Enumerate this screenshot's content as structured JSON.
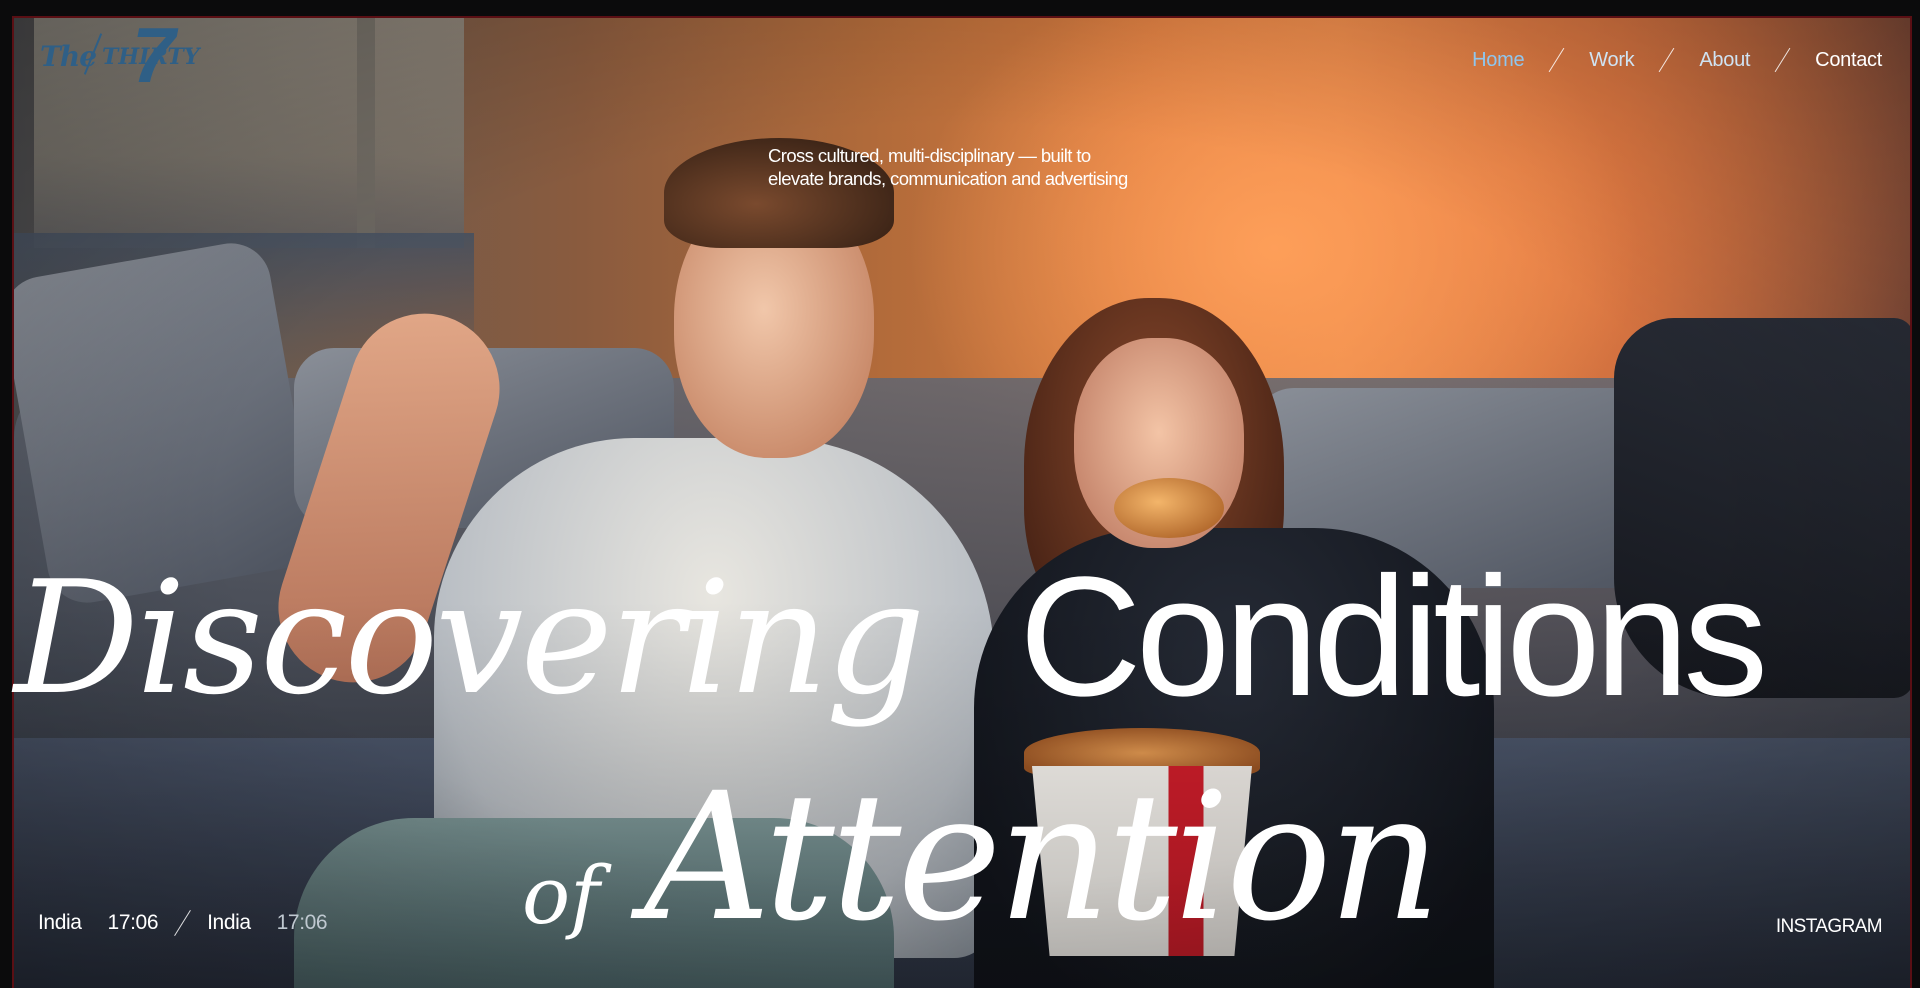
{
  "logo": {
    "the": "The",
    "thirty": "THIRTY",
    "seven": "7"
  },
  "nav": {
    "items": [
      {
        "label": "Home"
      },
      {
        "label": "Work"
      },
      {
        "label": "About"
      },
      {
        "label": "Contact"
      }
    ]
  },
  "hero": {
    "tagline_line1": "Cross cultured, multi-disciplinary — built to",
    "tagline_line2": "elevate brands, communication and advertising",
    "headline_word1": "Discovering",
    "headline_word2": "Conditions",
    "headline_word3": "of",
    "headline_word4": "Attention"
  },
  "footer": {
    "location1": "India",
    "time1": "17:06",
    "location2": "India",
    "time2": "17:06",
    "instagram": "INSTAGRAM"
  },
  "colors": {
    "nav_active": "#8fc6ee",
    "logo": "#2f5f86",
    "text": "#ffffff"
  }
}
